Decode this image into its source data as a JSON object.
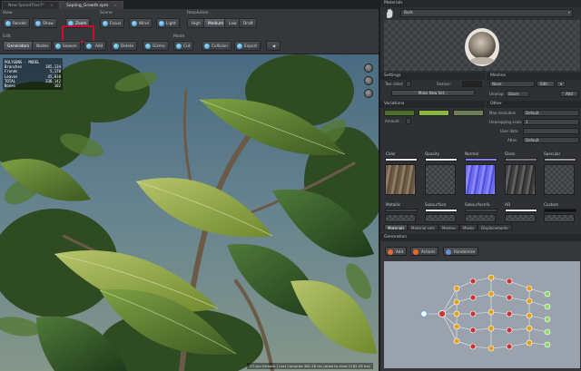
{
  "tabs": [
    "New SpeedTree7*",
    "Sapling_Growth.spm"
  ],
  "toolbar": {
    "view_label": "View",
    "view_buttons": [
      "Render",
      "Show",
      "Zoom"
    ],
    "scene_label": "Scene",
    "scene_buttons": [
      "Focus",
      "Wind",
      "Light"
    ],
    "resolution_label": "Resolution",
    "resolution_buttons": [
      "High",
      "Medium",
      "Low",
      "Draft"
    ],
    "edit_label": "Edit",
    "edit_buttons": [
      "Generators",
      "Nodes",
      "Season",
      "Add",
      "Delete",
      "Gizmo"
    ],
    "mode_label": "Mode",
    "mode_buttons": [
      "Cut",
      "Collision",
      "Export"
    ]
  },
  "stats": {
    "title": "POLYGONS - MODEL",
    "rows": [
      [
        "Branches",
        "185,134"
      ],
      [
        "Fronds",
        "5,170"
      ],
      [
        "Leaves",
        "45,838"
      ],
      [
        "TOTAL",
        "236,142"
      ],
      [
        "Bones",
        "102"
      ]
    ]
  },
  "status_text": "13 cpu threads | Last Compute 461.28 ms (draw to draw 2182.28 ms)",
  "materials": {
    "title": "Materials",
    "selected": "Bark",
    "settings_label": "Settings",
    "two_sided_label": "Two sided",
    "season_label": "Season:",
    "make_new_set": "Make New Set...",
    "meshes_label": "Meshes",
    "mesh_value": "None",
    "edit_btn": "Edit...",
    "unwrap_label": "Unwrap:",
    "unwrap_value": "Share",
    "add_btn": "Add",
    "variations_label": "Variations",
    "amount_label": "Amount",
    "other_label": "Other",
    "max_res_label": "Max resolution",
    "max_res_value": "Default",
    "unwrap_scale_label": "Unwrapping scale",
    "unwrap_scale_value": "1",
    "user_data_label": "User data",
    "atlas_label": "Atlas",
    "atlas_value": "Default",
    "channels": [
      "Color",
      "Opacity",
      "Normal",
      "Gloss",
      "Specular"
    ],
    "channels2": [
      "Metallic",
      "Subsurface",
      "Subsurface%",
      "AO",
      "Custom"
    ],
    "subtabs": [
      "Materials",
      "Material sets",
      "Meshes",
      "Masks",
      "Displacements"
    ]
  },
  "generation": {
    "title": "Generation",
    "buttons": [
      "Add",
      "Actions",
      "Randomize"
    ]
  },
  "colors": {
    "accent_red": "#c8102e",
    "variation_green": "#8db63f"
  }
}
